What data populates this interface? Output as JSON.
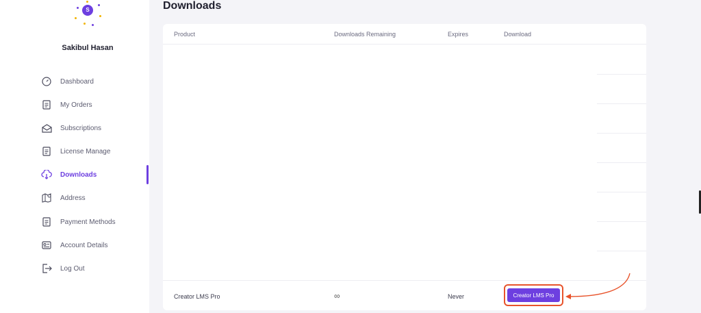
{
  "user": {
    "name": "Sakibul Hasan",
    "avatar_initial": "S",
    "accent_color": "#6d3fe0"
  },
  "sidebar": {
    "items": [
      {
        "label": "Dashboard",
        "icon": "gauge-icon",
        "active": false
      },
      {
        "label": "My Orders",
        "icon": "document-icon",
        "active": false
      },
      {
        "label": "Subscriptions",
        "icon": "envelope-icon",
        "active": false
      },
      {
        "label": "License Manage",
        "icon": "document-icon",
        "active": false
      },
      {
        "label": "Downloads",
        "icon": "cloud-download-icon",
        "active": true
      },
      {
        "label": "Address",
        "icon": "map-pin-icon",
        "active": false
      },
      {
        "label": "Payment Methods",
        "icon": "document-icon",
        "active": false
      },
      {
        "label": "Account Details",
        "icon": "id-card-icon",
        "active": false
      },
      {
        "label": "Log Out",
        "icon": "logout-icon",
        "active": false
      }
    ]
  },
  "page": {
    "title": "Downloads"
  },
  "table": {
    "columns": [
      "Product",
      "Downloads Remaining",
      "Expires",
      "Download"
    ],
    "rows": [
      {
        "product": "Creator LMS Pro",
        "downloads_remaining": "∞",
        "expires": "Never",
        "download_label": "Creator LMS Pro"
      }
    ]
  },
  "colors": {
    "highlight": "#e8532b",
    "button": "#6d3fe0"
  }
}
